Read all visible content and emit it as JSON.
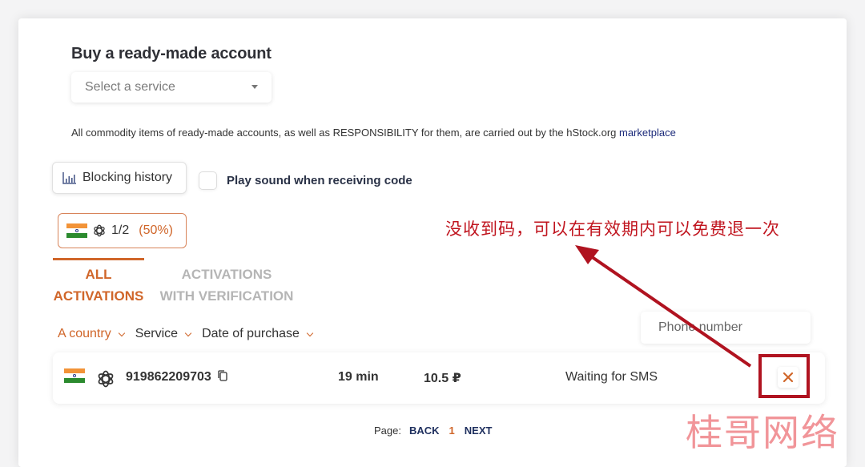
{
  "header": {
    "title": "Buy a ready-made account",
    "service_select": {
      "placeholder": "Select a service"
    }
  },
  "notice": {
    "text": "All commodity items of ready-made accounts, as well as RESPONSIBILITY for them, are carried out by the hStock.org ",
    "link_label": "marketplace"
  },
  "controls": {
    "blocking_history_label": "Blocking history",
    "blocking_history_icon": "bar-chart-icon",
    "play_sound_label": "Play sound when receiving code",
    "play_sound_checked": false
  },
  "stat_chip": {
    "country_icon": "india-flag-icon",
    "service_icon": "openai-icon",
    "ratio": "1/2",
    "percent": "(50%)"
  },
  "tabs": [
    {
      "label_line1": "ALL",
      "label_line2": "ACTIVATIONS",
      "active": true
    },
    {
      "label_line1": "ACTIVATIONS",
      "label_line2": "WITH VERIFICATION",
      "active": false
    }
  ],
  "filters": [
    {
      "label": "A country",
      "active": true
    },
    {
      "label": "Service",
      "active": false
    },
    {
      "label": "Date of purchase",
      "active": false
    }
  ],
  "phone_search": {
    "placeholder": "Phone number"
  },
  "activations": [
    {
      "country_icon": "india-flag-icon",
      "service_icon": "openai-icon",
      "phone": "919862209703",
      "time_left": "19 min",
      "price": "10.5 ₽",
      "status": "Waiting for SMS"
    }
  ],
  "pagination": {
    "label": "Page:",
    "back": "BACK",
    "current": "1",
    "next": "NEXT"
  },
  "annotation": {
    "text": "没收到码，可以在有效期内可以免费退一次",
    "color": "#c0141e"
  },
  "watermark": "桂哥网络",
  "colors": {
    "accent": "#d0662a",
    "navy": "#1e2f5e",
    "annotation_red": "#b01320"
  }
}
